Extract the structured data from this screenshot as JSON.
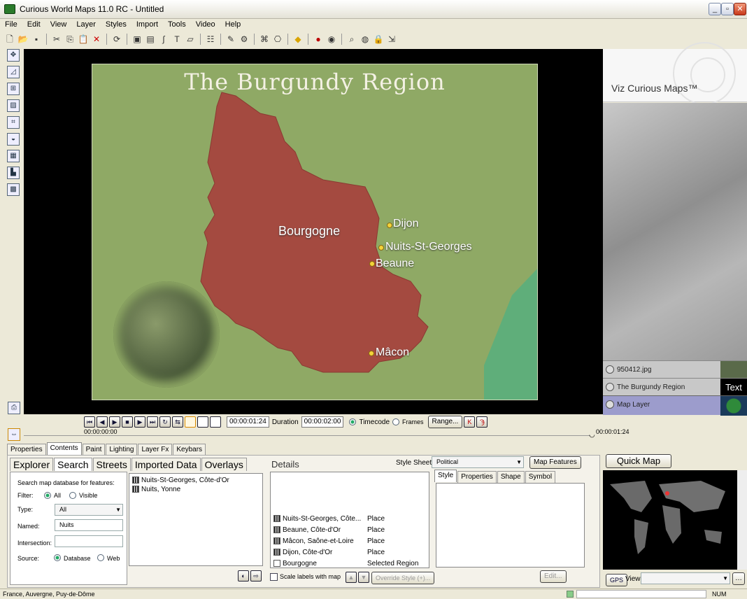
{
  "app": {
    "title": "Curious World Maps 11.0 RC - Untitled"
  },
  "menu": [
    "File",
    "Edit",
    "View",
    "Layer",
    "Styles",
    "Import",
    "Tools",
    "Video",
    "Help"
  ],
  "map": {
    "title": "The Burgundy Region",
    "region_label": "Bourgogne",
    "cities": [
      "Dijon",
      "Nuits-St-Georges",
      "Beaune",
      "Mâcon"
    ]
  },
  "right_panel": {
    "brand": "Viz Curious Maps™",
    "layers": [
      {
        "name": "950412.jpg",
        "badge": ""
      },
      {
        "name": "The Burgundy Region",
        "badge": "Text"
      },
      {
        "name": "Map Layer",
        "badge": ""
      }
    ]
  },
  "timeline": {
    "start": "00:00:00:00",
    "current": "00:00:01:24",
    "duration_label": "Duration",
    "duration": "00:00:02:00",
    "timecode_label": "Timecode",
    "frames_label": "Frames",
    "range_button": "Range...",
    "end_time": "00:00:01:24"
  },
  "panel_tabs": [
    "Properties",
    "Contents",
    "Paint",
    "Lighting",
    "Layer Fx",
    "Keybars"
  ],
  "content_tabs": [
    "Explorer",
    "Search",
    "Streets",
    "Imported Data",
    "Overlays"
  ],
  "search": {
    "heading": "Search map database for features:",
    "filter_label": "Filter:",
    "filter_all": "All",
    "filter_visible": "Visible",
    "type_label": "Type:",
    "type_value": "All",
    "named_label": "Named:",
    "named_value": "Nuits",
    "intersection_label": "Intersection:",
    "intersection_value": "",
    "source_label": "Source:",
    "source_database": "Database",
    "source_web": "Web"
  },
  "results": [
    "Nuits-St-Georges, Côte-d'Or",
    "Nuits, Yonne"
  ],
  "details": {
    "label": "Details",
    "stylesheet_label": "Style Sheet",
    "stylesheet_value": "Political",
    "map_features_button": "Map Features",
    "rows": [
      {
        "name": "Nuits-St-Georges, Côte...",
        "type": "Place"
      },
      {
        "name": "Beaune, Côte-d'Or",
        "type": "Place"
      },
      {
        "name": "Mâcon, Saône-et-Loire",
        "type": "Place"
      },
      {
        "name": "Dijon, Côte-d'Or",
        "type": "Place"
      },
      {
        "name": "Bourgogne",
        "type": "Selected Region"
      }
    ],
    "scale_labels": "Scale labels with map",
    "override_style": "Override Style (+)..."
  },
  "style_tabs": [
    "Style",
    "Properties",
    "Shape",
    "Symbol"
  ],
  "edit_button": "Edit...",
  "quick_map": {
    "button": "Quick Map",
    "gps": "GPS",
    "view_label": "View",
    "view_value": ""
  },
  "status": {
    "location": "France, Auvergne, Puy-de-Dôme",
    "num": "NUM"
  }
}
